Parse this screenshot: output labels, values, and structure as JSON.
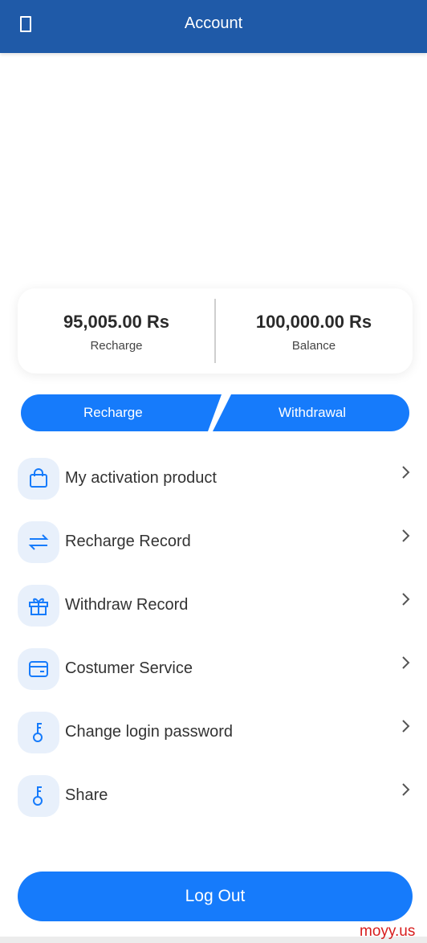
{
  "header": {
    "title": "Account"
  },
  "stats": {
    "recharge": {
      "value": "95,005.00 Rs",
      "label": "Recharge"
    },
    "balance": {
      "value": "100,000.00 Rs",
      "label": "Balance"
    }
  },
  "actions": {
    "recharge_label": "Recharge",
    "withdraw_label": "Withdrawal"
  },
  "menu": {
    "items": [
      {
        "label": "My activation product",
        "icon": "bag-icon"
      },
      {
        "label": "Recharge Record",
        "icon": "transfer-arrows-icon"
      },
      {
        "label": "Withdraw Record",
        "icon": "gift-icon"
      },
      {
        "label": "Costumer Service",
        "icon": "card-icon"
      },
      {
        "label": "Change login password",
        "icon": "key-icon"
      },
      {
        "label": "Share",
        "icon": "key-icon"
      }
    ]
  },
  "logout_label": "Log Out",
  "watermark": "moyy.us",
  "colors": {
    "header": "#1f5aa8",
    "accent": "#167bfb",
    "icon_bg": "#e8f0fb"
  }
}
